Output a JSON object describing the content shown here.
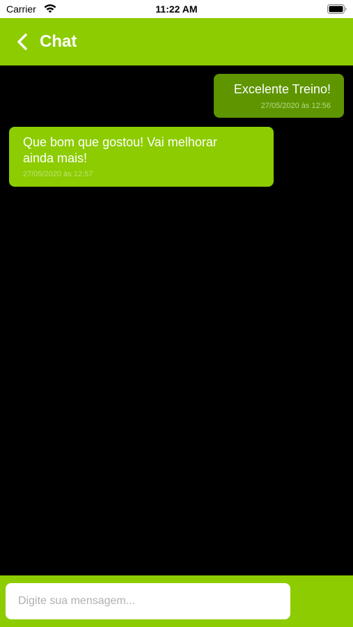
{
  "status_bar": {
    "carrier": "Carrier",
    "time": "11:22 AM"
  },
  "nav": {
    "title": "Chat"
  },
  "messages": [
    {
      "direction": "sent",
      "text": "Excelente Treino!",
      "timestamp": "27/05/2020 às 12:56"
    },
    {
      "direction": "received",
      "text": "Que bom que gostou! Vai melhorar ainda mais!",
      "timestamp": "27/05/2020 às 12:57"
    }
  ],
  "composer": {
    "placeholder": "Digite sua mensagem...",
    "value": ""
  },
  "colors": {
    "brand_green": "#8ccc00",
    "sent_bubble": "#5f9600",
    "background": "#000000"
  }
}
